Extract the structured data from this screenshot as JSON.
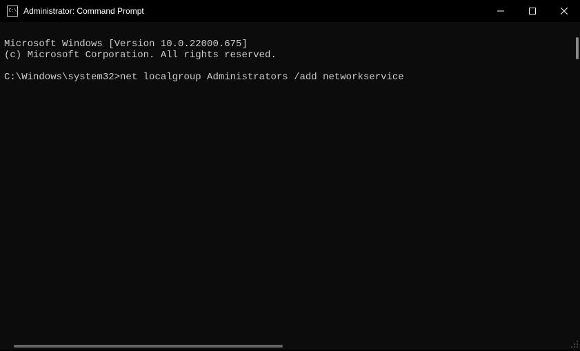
{
  "titlebar": {
    "icon_text": "C:\\",
    "title": "Administrator: Command Prompt"
  },
  "terminal": {
    "line1": "Microsoft Windows [Version 10.0.22000.675]",
    "line2": "(c) Microsoft Corporation. All rights reserved.",
    "blank": "",
    "prompt": "C:\\Windows\\system32>",
    "command": "net localgroup Administrators /add networkservice"
  }
}
